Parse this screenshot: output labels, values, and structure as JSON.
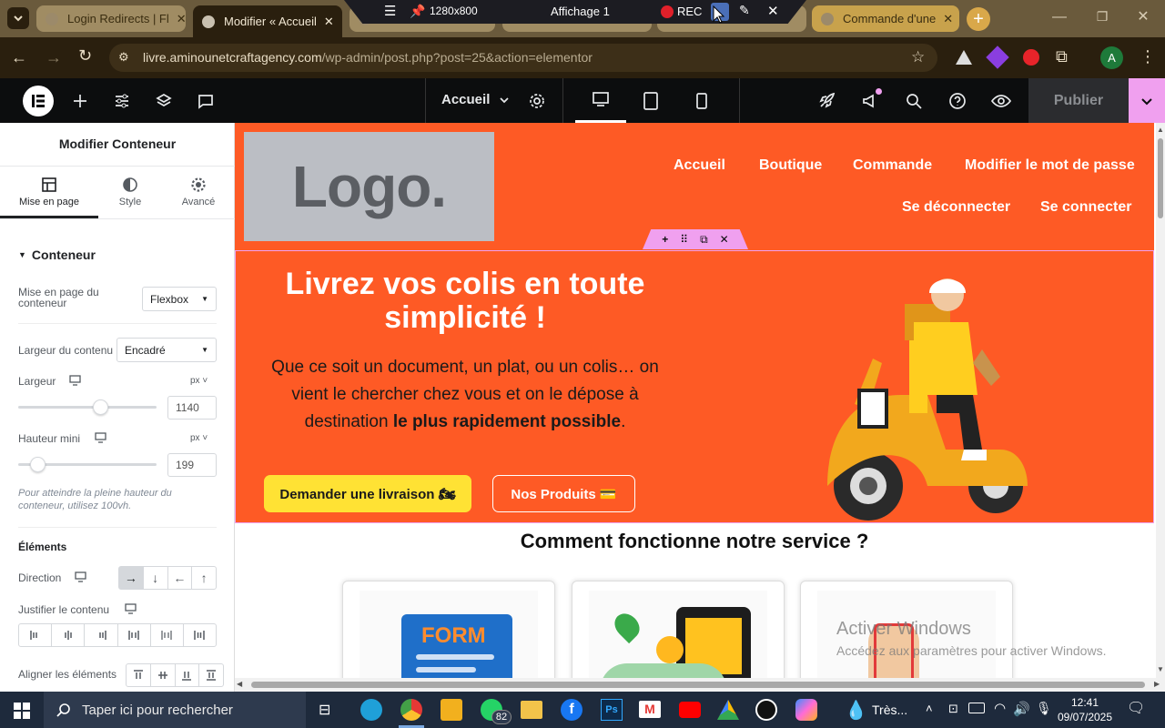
{
  "browser": {
    "tabs": [
      {
        "title": "Login Redirects | Fl",
        "active": false
      },
      {
        "title": "Modifier « Accueil",
        "active": true
      },
      {
        "title": "Commande d'une",
        "active": false
      }
    ],
    "url_host": "livre.aminounetcraftagency.com",
    "url_path": "/wp-admin/post.php?post=25&action=elementor",
    "profile_initial": "A"
  },
  "recorder": {
    "resolution": "1280x800",
    "display": "Affichage 1",
    "rec_label": "REC"
  },
  "elementor_bar": {
    "page_name": "Accueil",
    "publish_label": "Publier"
  },
  "panel": {
    "title": "Modifier Conteneur",
    "tabs": [
      "Mise en page",
      "Style",
      "Avancé"
    ],
    "section_title": "Conteneur",
    "layout_label": "Mise en page du conteneur",
    "layout_value": "Flexbox",
    "content_width_label": "Largeur du contenu",
    "content_width_value": "Encadré",
    "width_label": "Largeur",
    "width_unit": "px",
    "width_value": "1140",
    "width_slider_fraction": 0.59,
    "min_height_label": "Hauteur mini",
    "min_height_unit": "px",
    "min_height_value": "199",
    "min_height_slider_fraction": 0.14,
    "min_height_hint": "Pour atteindre la pleine hauteur du conteneur, utilisez 100vh.",
    "elements_title": "Éléments",
    "direction_label": "Direction",
    "justify_label": "Justifier le contenu",
    "align_label": "Aligner les éléments"
  },
  "site": {
    "logo_text": "Logo.",
    "nav_items": [
      "Accueil",
      "Boutique",
      "Commande",
      "Modifier le mot de passe",
      "Se déconnecter",
      "Se connecter"
    ],
    "hero_title": "Livrez vos colis en toute simplicité !",
    "hero_text": "Que ce soit un document, un plat, ou un colis… on vient le chercher chez vous et on le dépose à destination ",
    "hero_text_bold": "le plus rapidement possible",
    "hero_text_end": ".",
    "btn_delivery": "Demander une livraison 🏍",
    "btn_products": "Nos Produits 💳",
    "section_title": "Comment fonctionne notre service ?",
    "card1_label": "FORM",
    "watermark_line1": "Activer Windows",
    "watermark_line2": "Accédez aux paramètres pour activer Windows."
  },
  "taskbar": {
    "search_placeholder": "Taper ici pour rechercher",
    "whatsapp_badge": "82",
    "weather": "Très...",
    "time": "12:41",
    "date": "09/07/2025"
  },
  "colors": {
    "accent_orange": "#fe5a25",
    "button_yellow": "#ffe234",
    "elementor_dark": "#0c0d0e",
    "publish_bg": "#2b2c2f",
    "pink_handle": "#f0a0ef"
  }
}
